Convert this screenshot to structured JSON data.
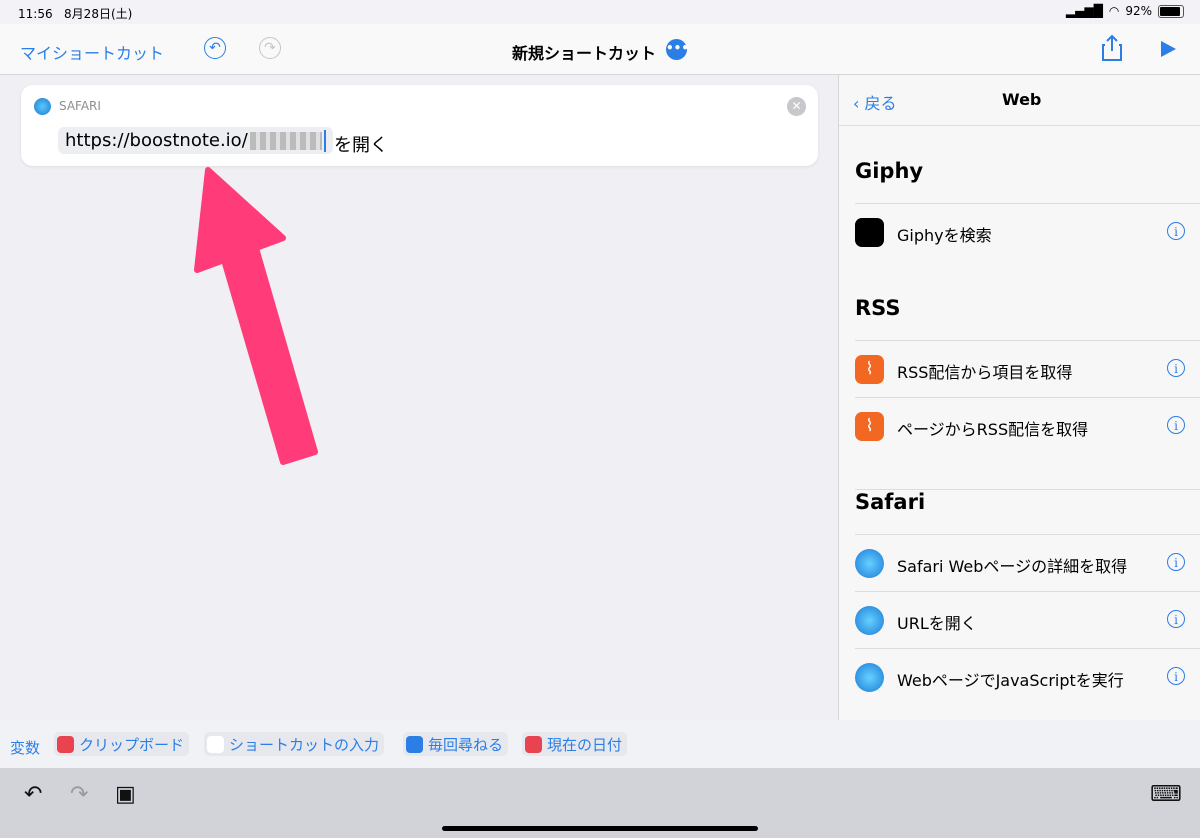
{
  "status": {
    "time": "11:56",
    "date": "8月28日(土)",
    "battery": "92%",
    "battery_level": 0.92
  },
  "nav": {
    "back": "マイショートカット",
    "title": "新規ショートカット",
    "more": "•••"
  },
  "card": {
    "app": "SAFARI",
    "url": "https://boostnote.io/",
    "suffix": "を開く"
  },
  "sidebar": {
    "back": "戻る",
    "title": "Web",
    "sections": [
      {
        "title": "Giphy",
        "items": [
          "Giphyを検索"
        ]
      },
      {
        "title": "RSS",
        "items": [
          "RSS配信から項目を取得",
          "ページからRSS配信を取得"
        ]
      },
      {
        "title": "Safari",
        "items": [
          "Safari Webページの詳細を取得",
          "URLを開く",
          "WebページでJavaScriptを実行"
        ]
      }
    ]
  },
  "vars": {
    "label": "変数",
    "chips": [
      "クリップボード",
      "ショートカットの入力",
      "毎回尋ねる",
      "現在の日付"
    ]
  },
  "colors": {
    "accent": "#2a7ee6",
    "arrow": "#ff3b79",
    "rss": "#f26722"
  }
}
